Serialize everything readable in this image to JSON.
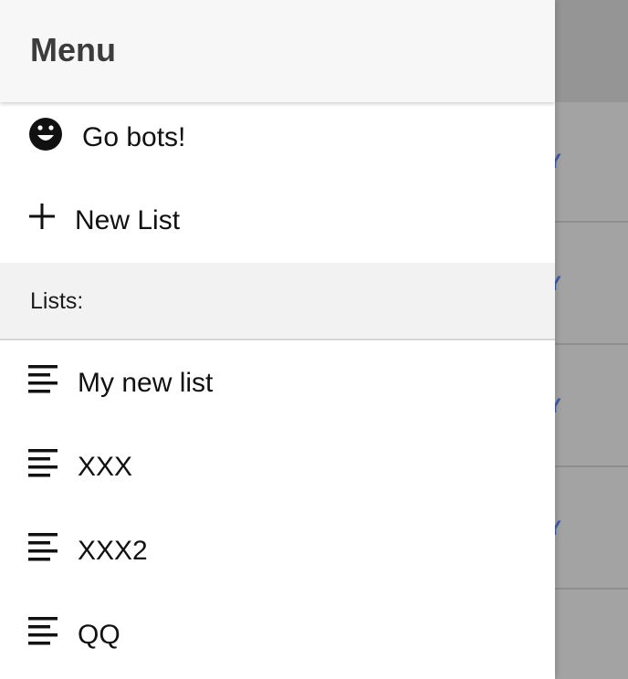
{
  "drawer": {
    "title": "Menu",
    "actions": [
      {
        "icon": "smiley-face-icon",
        "label": "Go bots!"
      },
      {
        "icon": "plus-icon",
        "label": "New List"
      }
    ],
    "section_label": "Lists:",
    "lists": [
      {
        "icon": "list-lines-icon",
        "label": "My new list"
      },
      {
        "icon": "list-lines-icon",
        "label": "XXX"
      },
      {
        "icon": "list-lines-icon",
        "label": "XXX2"
      },
      {
        "icon": "list-lines-icon",
        "label": "QQ"
      }
    ]
  },
  "background": {
    "row_labels": [
      "LAY",
      "LAY",
      "LAY",
      "LAY"
    ],
    "accent_color": "#3f5aa6"
  }
}
